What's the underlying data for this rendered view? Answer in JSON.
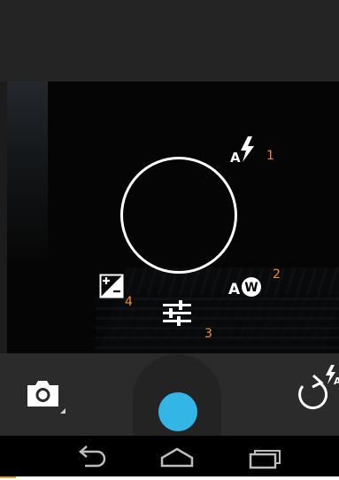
{
  "camera": {
    "options": {
      "flash": {
        "icon": "flash-auto-icon",
        "label": "A",
        "number": "1"
      },
      "white_balance": {
        "icon": "auto-white-balance-icon",
        "label": "A",
        "badge": "W",
        "number": "2"
      },
      "settings": {
        "icon": "settings-sliders-icon",
        "number": "3"
      },
      "exposure": {
        "icon": "exposure-compensation-icon",
        "number": "4"
      }
    },
    "controls": {
      "mode_icon": "camera-mode-icon",
      "shutter_icon": "shutter-button",
      "switch_icon": "switch-camera-icon"
    }
  },
  "navigation": {
    "back_icon": "back-icon",
    "home_icon": "home-icon",
    "recent_icon": "recent-apps-icon"
  },
  "colors": {
    "accent": "#33b5e5",
    "annotation": "#f08c2c",
    "overlay_icons": "#ffffff"
  }
}
